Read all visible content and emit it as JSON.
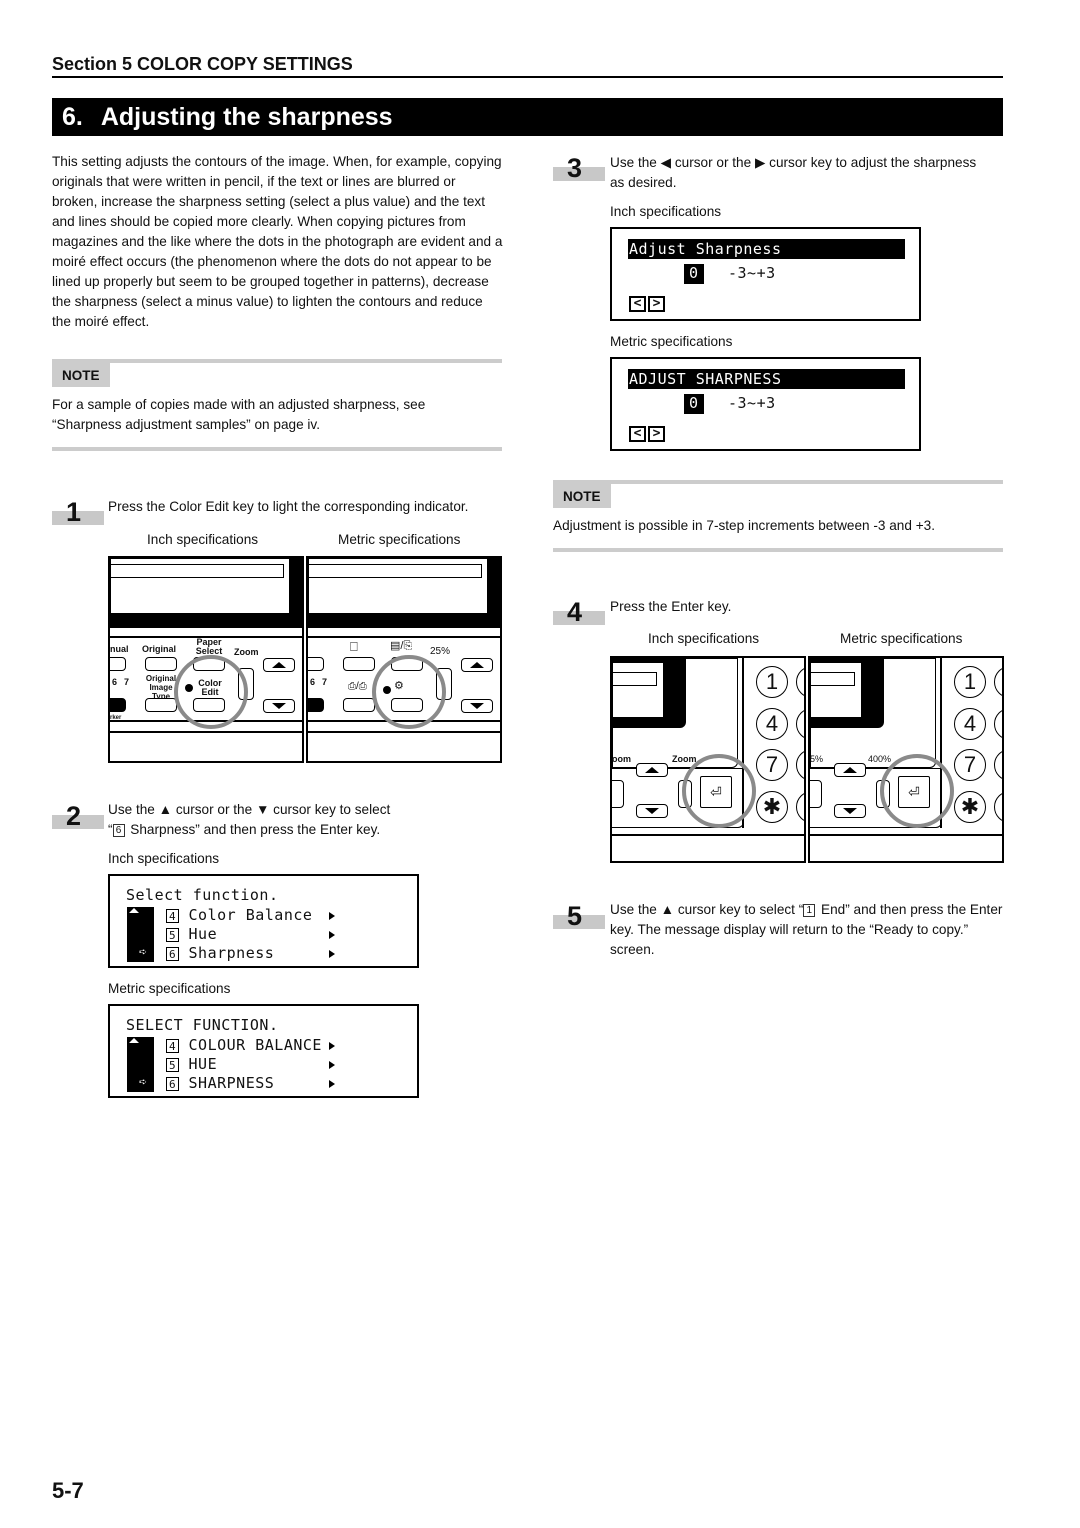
{
  "section_header": "Section 5  COLOR COPY SETTINGS",
  "title": {
    "number": "6.",
    "text": "Adjusting the sharpness"
  },
  "intro": "This setting adjusts the contours of the image. When, for example, copying originals that were written in pencil, if the text or lines are blurred or broken, increase the sharpness setting (select a plus value) and the text and lines should be copied more clearly. When copying pictures from magazines and the like where the dots in the photograph are evident and a moiré effect occurs (the phenomenon where the dots do not appear to be lined up properly but seem to be grouped together in patterns), decrease the sharpness (select a minus value) to lighten the contours and reduce the moiré effect.",
  "note1": {
    "label": "NOTE",
    "text": "For a sample of copies made with an adjusted sharpness, see “Sharpness adjustment samples” on page iv."
  },
  "note2": {
    "label": "NOTE",
    "text": "Adjustment is possible in 7-step increments between -3 and +3."
  },
  "labels": {
    "inch": "Inch specifications",
    "metric": "Metric specifications"
  },
  "steps": {
    "s1": {
      "num": "1",
      "text": "Press the Color Edit key to light the corresponding indicator."
    },
    "s2": {
      "num": "2",
      "text_a": "Use the ▲ cursor or the ▼ cursor key to select",
      "quote_open": "“",
      "key": "6",
      "text_b": " Sharpness” and then press the Enter key."
    },
    "s3": {
      "num": "3",
      "text": "Use the ◀ cursor or the ▶ cursor key to adjust the sharpness as desired."
    },
    "s4": {
      "num": "4",
      "text": "Press the Enter key."
    },
    "s5": {
      "num": "5",
      "text_a": "Use the ▲ cursor key to select “",
      "key": "1",
      "text_b": " End” and then press the Enter key. The message display will return to the “Ready to copy.” screen."
    }
  },
  "panel1": {
    "inch": {
      "manual": "nual",
      "original": "Original",
      "paper_select": "Paper Select",
      "zoom": "Zoom",
      "zoom_sub": "(–)",
      "original_image_type": "Original Image Type",
      "color_edit": "Color Edit",
      "marker": "rker",
      "num6": "6",
      "num7": "7"
    },
    "metric": {
      "pct": "25%",
      "num6": "6",
      "num7": "7"
    }
  },
  "lcd_select": {
    "inch": {
      "title": "Select function.",
      "items": [
        {
          "key": "4",
          "label": "Color Balance"
        },
        {
          "key": "5",
          "label": "Hue"
        },
        {
          "key": "6",
          "label": "Sharpness"
        }
      ]
    },
    "metric": {
      "title": "SELECT FUNCTION.",
      "items": [
        {
          "key": "4",
          "label": "COLOUR BALANCE"
        },
        {
          "key": "5",
          "label": "HUE"
        },
        {
          "key": "6",
          "label": "SHARPNESS"
        }
      ]
    }
  },
  "lcd_adjust": {
    "inch": {
      "title": "Adjust Sharpness",
      "value": "0",
      "range": "-3~+3"
    },
    "metric": {
      "title": "ADJUST SHARPNESS",
      "value": "0",
      "range": "-3~+3"
    }
  },
  "panel4": {
    "inch": {
      "zoom_left": "oom",
      "zoom_right": "Zoom",
      "keys": [
        "1",
        "4",
        "7",
        "✱"
      ]
    },
    "metric": {
      "pct_left": "5%",
      "pct_right": "400%",
      "keys": [
        "1",
        "4",
        "7",
        "✱"
      ]
    }
  },
  "page_number": "5-7"
}
